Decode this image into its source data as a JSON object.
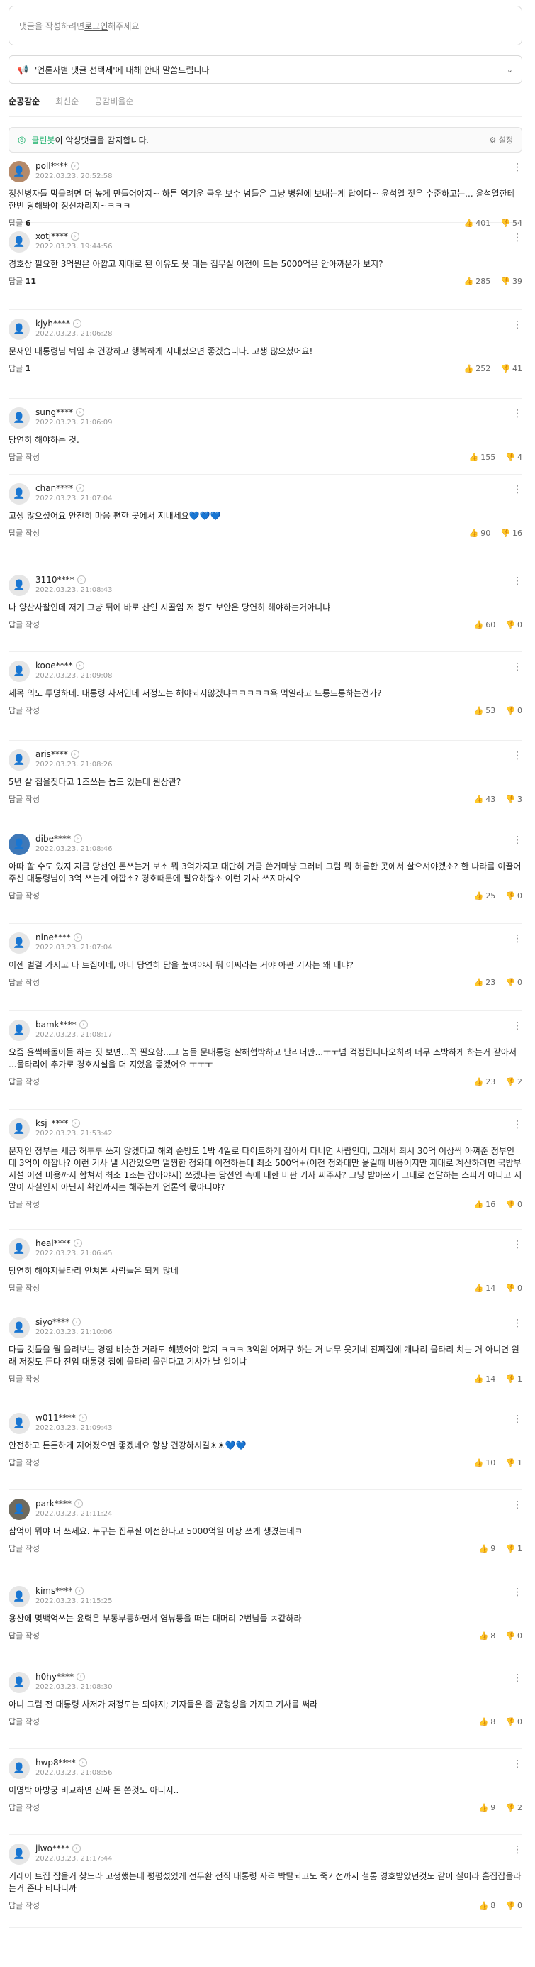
{
  "input": {
    "before": "댓글을 작성하려면 ",
    "login": "로그인",
    "after": " 해주세요"
  },
  "notice": {
    "text": "'언론사별 댓글 선택제'에 대해 안내 말씀드립니다"
  },
  "sort": [
    "순공감순",
    "최신순",
    "공감비율순"
  ],
  "bot": {
    "name": "클린봇",
    "text": "이 악성댓글을 감지합니다.",
    "settings": "설정"
  },
  "comments": [
    {
      "nick": "poll****",
      "date": "2022.03.23. 20:52:58",
      "text": "정신병자들 막을려면 더 높게 만들어야지~ 하튼 역겨운 극우 보수 넘들은 그냥 병원에 보내는게 답이다~ 윤석열 짓은 수준하고는... 윤석열한테 한번 당해봐야 정신차리지~ㅋㅋㅋ",
      "reply": "답글",
      "replyCount": "6",
      "up": "401",
      "down": "54",
      "h": 98
    },
    {
      "nick": "xotj****",
      "date": "2022.03.23. 19:44:56",
      "text": "경호상 필요한 3억원은 아깝고 제대로 된 이유도 못 대는 집무실 이전에 드는 5000억은 안아까운가 보지?",
      "reply": "답글",
      "replyCount": "11",
      "up": "285",
      "down": "39",
      "h": 122
    },
    {
      "nick": "kjyh****",
      "date": "2022.03.23. 21:06:28",
      "text": "문재인 대통령님 퇴임 후 건강하고 행복하게 지내셨으면 좋겠습니다. 고생 많으셨어요!",
      "reply": "답글",
      "replyCount": "1",
      "up": "252",
      "down": "41",
      "h": 124
    },
    {
      "nick": "sung****",
      "date": "2022.03.23. 21:06:09",
      "text": "당연히 해야하는 것.",
      "reply": "답글 작성",
      "replyCount": "",
      "up": "155",
      "down": "4",
      "h": 106
    },
    {
      "nick": "chan****",
      "date": "2022.03.23. 21:07:04",
      "text": "고생 많으셨어요 안전히 마음 편한 곳에서 지내세요",
      "hearts": "💙💙💙",
      "reply": "답글 작성",
      "replyCount": "",
      "up": "90",
      "down": "16",
      "h": 128
    },
    {
      "nick": "3110****",
      "date": "2022.03.23. 21:08:43",
      "text": "나 양산사찰인데 저기 그냥 뒤에 바로 산인 시골임 저 정도 보안은 당연히 해야하는거아니냐",
      "reply": "답글 작성",
      "replyCount": "",
      "up": "60",
      "down": "0",
      "h": 120
    },
    {
      "nick": "kooe****",
      "date": "2022.03.23. 21:09:08",
      "text": "제목 의도 투명하네. 대통령 사저인데 저정도는 해야되지않겠냐ㅋㅋㅋㅋㅋ욕 먹일라고 드릉드릉하는건가?",
      "reply": "답글 작성",
      "replyCount": "",
      "up": "53",
      "down": "0",
      "h": 124
    },
    {
      "nick": "aris****",
      "date": "2022.03.23. 21:08:26",
      "text": "5년 살 집을짓다고 1조쓰는 놈도 있는데 뭔상관?",
      "reply": "답글 작성",
      "replyCount": "",
      "up": "43",
      "down": "3",
      "h": 118
    },
    {
      "nick": "dibe****",
      "date": "2022.03.23. 21:08:46",
      "text": "아따 할 수도 있지 지금 당선인 돈쓰는거 보소 뭐 3억가지고 대단히 거금 쓴거마냥 그러네 그럼 뭐 허름한 곳에서 살으셔야겠소? 한 나라를 이끌어주신 대통령님이 3억 쓰는게 아깝소? 경호때문에 필요하잖소 이런 기사 쓰지마시오",
      "reply": "답글 작성",
      "replyCount": "",
      "up": "25",
      "down": "0",
      "h": 138
    },
    {
      "nick": "nine****",
      "date": "2022.03.23. 21:07:04",
      "text": "이젠 별걸 가지고 다 트집이네, 아니 당연히 담을 높여야지 뭐 어쩌라는 거야 아판 기사는 왜 내냐?",
      "reply": "답글 작성",
      "replyCount": "",
      "up": "23",
      "down": "0",
      "h": 122
    },
    {
      "nick": "bamk****",
      "date": "2022.03.23. 21:08:17",
      "text": "요즘 윤썩빠돌이들 하는 짓 보면...꼭 필요함...그 놈들 문대통령 살해협박하고 난리더만...ㅜㅜ넘 걱정됩니다오히려 너무 소박하게 하는거 같아서 ...울타리에 추가로 경호시설을 더 지었음 좋겠어요 ㅜㅜㅜ",
      "reply": "답글 작성",
      "replyCount": "",
      "up": "23",
      "down": "2",
      "h": 138
    },
    {
      "nick": "ksj_****",
      "date": "2022.03.23. 21:53:42",
      "text": "문재인 정부는 세금 허투루 쓰지 않겠다고 해외 순방도 1박 4일로 타이트하게 잡아서 다니면 사람인데, 그래서 최시 30억 이상씩 아껴준 정부인데 3억이 아깝나? 이런 기사 낼 시간있으면 멀쩡한 청와대 이전하는데 최소 500억+(이전 청와대만 옮길때 비용이지만 제대로 계산하려면 국방부 시설 이전 비용까지 합쳐서 최소 1조는 잡아야지) 쓰겠다는 당선인 측에 대한 비판 기사 써주자? 그냥 받아쓰기 그대로 전달하는 스피커 아니고 저 말이 사실인지 아닌지 확인까지는 해주는게 언론의 몫아니야?",
      "reply": "답글 작성",
      "replyCount": "",
      "up": "16",
      "down": "0",
      "h": 168
    },
    {
      "nick": "heal****",
      "date": "2022.03.23. 21:06:45",
      "text": "당연히 해야지울타리 안쳐본 사람들은 되게 많네",
      "reply": "답글 작성",
      "replyCount": "",
      "up": "14",
      "down": "0",
      "h": 110
    },
    {
      "nick": "siyo****",
      "date": "2022.03.23. 21:10:06",
      "text": "다들 갓들을 뭘 을려보는 경험 비슷한 거라도 해봤어야 알지 ㅋㅋㅋ 3억원 어쩌구 하는 거 너무 웃기네 진짜집에 개나리 울타리 치는 거 아니면 원래 저정도 든다 전임 대통령 집에 울타리 올린다고 기사가 날 일이냐",
      "reply": "답글 작성",
      "replyCount": "",
      "up": "14",
      "down": "1",
      "h": 134
    },
    {
      "nick": "w011****",
      "date": "2022.03.23. 21:09:43",
      "text": "안전하고 튼튼하게 지어졌으면 좋겠네요 항상 건강하시길☀☀",
      "hearts": "💙💙",
      "reply": "답글 작성",
      "replyCount": "",
      "up": "10",
      "down": "1",
      "h": 120
    },
    {
      "nick": "park****",
      "date": "2022.03.23. 21:11:24",
      "text": "삼억이 뭐야 더 쓰세요. 누구는 집무실 이전한다고 5000억원 이상 쓰게 생겼는데ㅋ",
      "reply": "답글 작성",
      "replyCount": "",
      "up": "9",
      "down": "1",
      "h": 122
    },
    {
      "nick": "kims****",
      "date": "2022.03.23. 21:15:25",
      "text": "용산에 몇백억쓰는 윤력은 부동부동하면서 염뷰등을 떠는 대머리 2번남들 ㅈ같하라",
      "reply": "답글 작성",
      "replyCount": "",
      "up": "8",
      "down": "0",
      "h": 120
    },
    {
      "nick": "h0hy****",
      "date": "2022.03.23. 21:08:30",
      "text": "아니 그럼 전 대통령 사저가 저정도는 되야지; 기자들은 좀 균형성을 가지고 기사를 써라",
      "reply": "답글 작성",
      "replyCount": "",
      "up": "8",
      "down": "0",
      "h": 120
    },
    {
      "nick": "hwp8****",
      "date": "2022.03.23. 21:08:56",
      "text": "이명박 아방궁 비교하면 진짜 돈 쓴것도 아니지..",
      "reply": "답글 작성",
      "replyCount": "",
      "up": "9",
      "down": "2",
      "h": 120
    },
    {
      "nick": "jiwo****",
      "date": "2022.03.23. 21:17:44",
      "text": "기레이 트집 잡을거 찾느라 고생했는데 평평섰있게 전두환 전직 대통령 자격 박탈되고도 죽기전까지 철통 경호받았던것도 같이 실어라 흠집잡을라는거 존나 티나니까",
      "reply": "답글 작성",
      "replyCount": "",
      "up": "8",
      "down": "0",
      "h": 130
    }
  ]
}
